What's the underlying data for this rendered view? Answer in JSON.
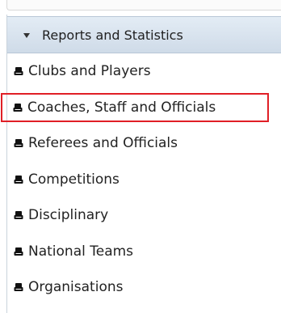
{
  "panel": {
    "header_label": "Reports and Statistics",
    "header_caret_icon": "caret-down-icon",
    "item_icon": "report-icon",
    "items": [
      {
        "label": "Clubs and Players"
      },
      {
        "label": "Coaches, Staff and Officials"
      },
      {
        "label": "Referees and Officials"
      },
      {
        "label": "Competitions"
      },
      {
        "label": "Disciplinary"
      },
      {
        "label": "National Teams"
      },
      {
        "label": "Organisations"
      }
    ]
  },
  "colors": {
    "highlight_border": "#e01f26",
    "header_gradient_top": "#e3ecf5",
    "header_gradient_bottom": "#cfdbe8",
    "text": "#222222"
  }
}
